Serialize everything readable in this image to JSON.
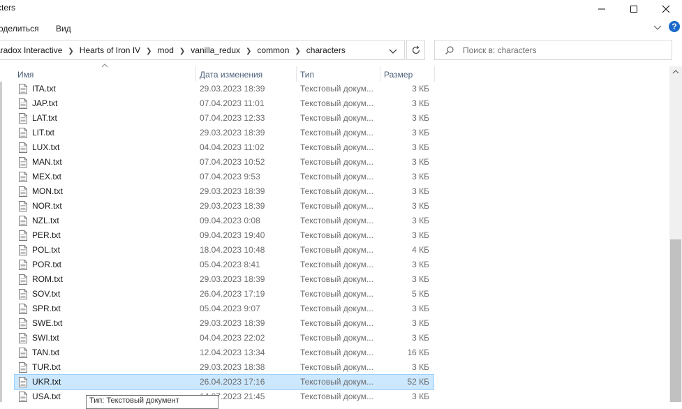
{
  "window": {
    "title": "cters"
  },
  "ribbon": {
    "share_label": "оделиться",
    "view_label": "Вид"
  },
  "address": {
    "crumbs": [
      "aradox Interactive",
      "Hearts of Iron IV",
      "mod",
      "vanilla_redux",
      "common",
      "characters"
    ]
  },
  "search": {
    "placeholder": "Поиск в: characters"
  },
  "columns": {
    "name": "Имя",
    "date": "Дата изменения",
    "type": "Тип",
    "size": "Размер"
  },
  "files": [
    {
      "name": "ITA.txt",
      "date": "29.03.2023 18:39",
      "type": "Текстовый докум...",
      "size": "3 КБ"
    },
    {
      "name": "JAP.txt",
      "date": "07.04.2023 11:01",
      "type": "Текстовый докум...",
      "size": "3 КБ"
    },
    {
      "name": "LAT.txt",
      "date": "07.04.2023 12:33",
      "type": "Текстовый докум...",
      "size": "3 КБ"
    },
    {
      "name": "LIT.txt",
      "date": "29.03.2023 18:39",
      "type": "Текстовый докум...",
      "size": "3 КБ"
    },
    {
      "name": "LUX.txt",
      "date": "04.04.2023 11:02",
      "type": "Текстовый докум...",
      "size": "3 КБ"
    },
    {
      "name": "MAN.txt",
      "date": "07.04.2023 10:52",
      "type": "Текстовый докум...",
      "size": "3 КБ"
    },
    {
      "name": "MEX.txt",
      "date": "07.04.2023 9:53",
      "type": "Текстовый докум...",
      "size": "3 КБ"
    },
    {
      "name": "MON.txt",
      "date": "29.03.2023 18:39",
      "type": "Текстовый докум...",
      "size": "3 КБ"
    },
    {
      "name": "NOR.txt",
      "date": "29.03.2023 18:39",
      "type": "Текстовый докум...",
      "size": "3 КБ"
    },
    {
      "name": "NZL.txt",
      "date": "09.04.2023 0:08",
      "type": "Текстовый докум...",
      "size": "3 КБ"
    },
    {
      "name": "PER.txt",
      "date": "09.04.2023 19:40",
      "type": "Текстовый докум...",
      "size": "3 КБ"
    },
    {
      "name": "POL.txt",
      "date": "18.04.2023 10:48",
      "type": "Текстовый докум...",
      "size": "4 КБ"
    },
    {
      "name": "POR.txt",
      "date": "05.04.2023 8:41",
      "type": "Текстовый докум...",
      "size": "3 КБ"
    },
    {
      "name": "ROM.txt",
      "date": "29.03.2023 18:39",
      "type": "Текстовый докум...",
      "size": "3 КБ"
    },
    {
      "name": "SOV.txt",
      "date": "26.04.2023 17:19",
      "type": "Текстовый докум...",
      "size": "5 КБ"
    },
    {
      "name": "SPR.txt",
      "date": "05.04.2023 9:07",
      "type": "Текстовый докум...",
      "size": "3 КБ"
    },
    {
      "name": "SWE.txt",
      "date": "29.03.2023 18:39",
      "type": "Текстовый докум...",
      "size": "3 КБ"
    },
    {
      "name": "SWI.txt",
      "date": "04.04.2023 22:02",
      "type": "Текстовый докум...",
      "size": "3 КБ"
    },
    {
      "name": "TAN.txt",
      "date": "12.04.2023 13:34",
      "type": "Текстовый докум...",
      "size": "16 КБ"
    },
    {
      "name": "TUR.txt",
      "date": "29.03.2023 18:38",
      "type": "Текстовый докум...",
      "size": "3 КБ"
    },
    {
      "name": "UKR.txt",
      "date": "26.04.2023 17:16",
      "type": "Текстовый докум...",
      "size": "52 КБ",
      "selected": true
    },
    {
      "name": "USA.txt",
      "date": "14.07.2023 21:45",
      "type": "Текстовый докум...",
      "size": "3 КБ"
    }
  ],
  "tooltip": {
    "text": "Тип: Текстовый документ"
  },
  "colors": {
    "selection_bg": "#cce8ff",
    "selection_border": "#99d1ff",
    "header_text": "#4c607a",
    "help_blue": "#1b6ac9"
  }
}
